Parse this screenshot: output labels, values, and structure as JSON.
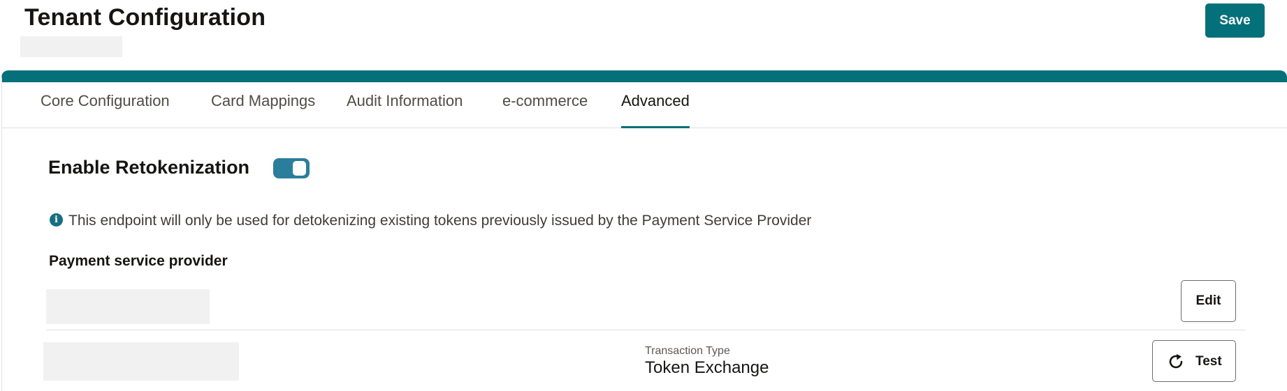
{
  "header": {
    "title": "Tenant Configuration",
    "save_label": "Save"
  },
  "tabs": [
    {
      "label": "Core Configuration",
      "active": false
    },
    {
      "label": "Card Mappings",
      "active": false
    },
    {
      "label": "Audit Information",
      "active": false
    },
    {
      "label": "e-commerce",
      "active": false
    },
    {
      "label": "Advanced",
      "active": true
    }
  ],
  "advanced": {
    "retokenization_label": "Enable Retokenization",
    "retokenization_enabled": true,
    "info_icon": "info-icon",
    "info_text": "This endpoint will only be used for detokenizing existing tokens previously issued by the Payment Service Provider",
    "psp_heading": "Payment service provider",
    "edit_label": "Edit",
    "transaction_type_label": "Transaction Type",
    "transaction_type_value": "Token Exchange",
    "test_label": "Test",
    "test_icon": "refresh-icon"
  },
  "colors": {
    "accent": "#04707a",
    "toggle_on": "#2a7e9b",
    "placeholder": "#f1f1f1"
  }
}
